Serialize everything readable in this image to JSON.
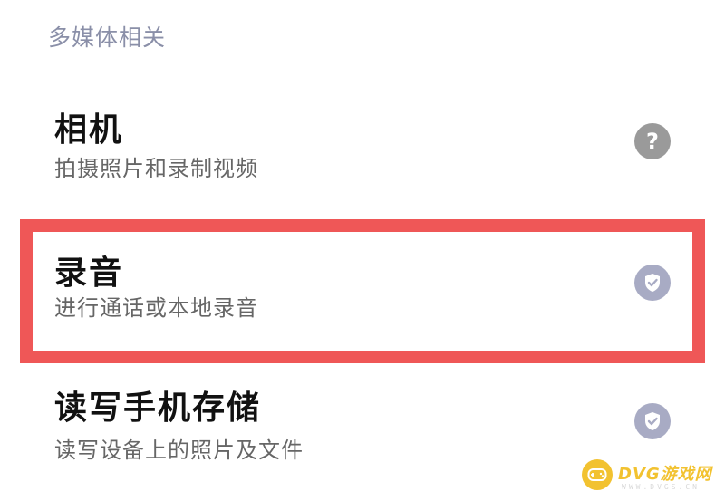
{
  "section": {
    "title": "多媒体相关"
  },
  "permissions": [
    {
      "title": "相机",
      "description": "拍摄照片和录制视频",
      "status": "unknown",
      "status_icon": "question-icon",
      "status_glyph": "?"
    },
    {
      "title": "录音",
      "description": "进行通话或本地录音",
      "status": "granted",
      "status_icon": "check-shield-icon"
    },
    {
      "title": "读写手机存储",
      "description": "读写设备上的照片及文件",
      "status": "granted",
      "status_icon": "check-shield-icon"
    }
  ],
  "highlight": {
    "color": "#ef5757"
  },
  "watermark": {
    "text": "DVG游戏网",
    "subtext": "WWW.DVGS.CN",
    "color": "#f2c230"
  }
}
